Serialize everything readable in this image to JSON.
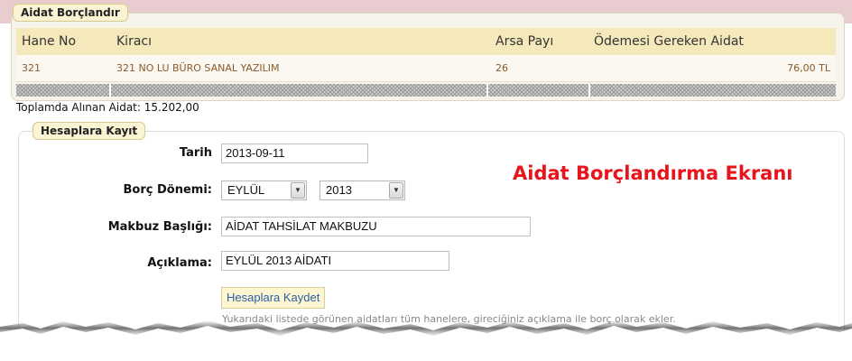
{
  "panel_debit": {
    "legend": "Aidat Borçlandır",
    "columns": [
      "Hane No",
      "Kiracı",
      "Arsa Payı",
      "Ödemesi Gereken Aidat"
    ],
    "rows": [
      {
        "hane_no": "321",
        "kiraci": "321 NO LU BÜRO SANAL YAZILIM",
        "arsa_payi": "26",
        "aidat": "76,00 TL"
      }
    ]
  },
  "total_label": "Toplamda Alınan Aidat: 15.202,00",
  "panel_accounts": {
    "legend": "Hesaplara Kayıt",
    "date_label": "Tarih",
    "date_value": "2013-09-11",
    "period_label": "Borç Dönemi:",
    "period_month": "EYLÜL",
    "period_year": "2013",
    "receipt_label": "Makbuz Başlığı:",
    "receipt_value": "AİDAT TAHSİLAT MAKBUZU",
    "desc_label": "Açıklama:",
    "desc_value": "EYLÜL 2013 AİDATI",
    "save_button": "Hesaplara Kaydet",
    "hint": "Yukarıdaki listede görünen aidatları tüm hanelere, gireciğiniz açıklama ile borç olarak ekler."
  },
  "overlay_title": "Aidat Borçlandırma Ekranı",
  "icons": {
    "dropdown_arrow": "chevron-down-icon"
  },
  "colors": {
    "accent_red": "#e8141c",
    "header_bg": "#f5e9bc",
    "link_blue": "#2a5fa8"
  }
}
